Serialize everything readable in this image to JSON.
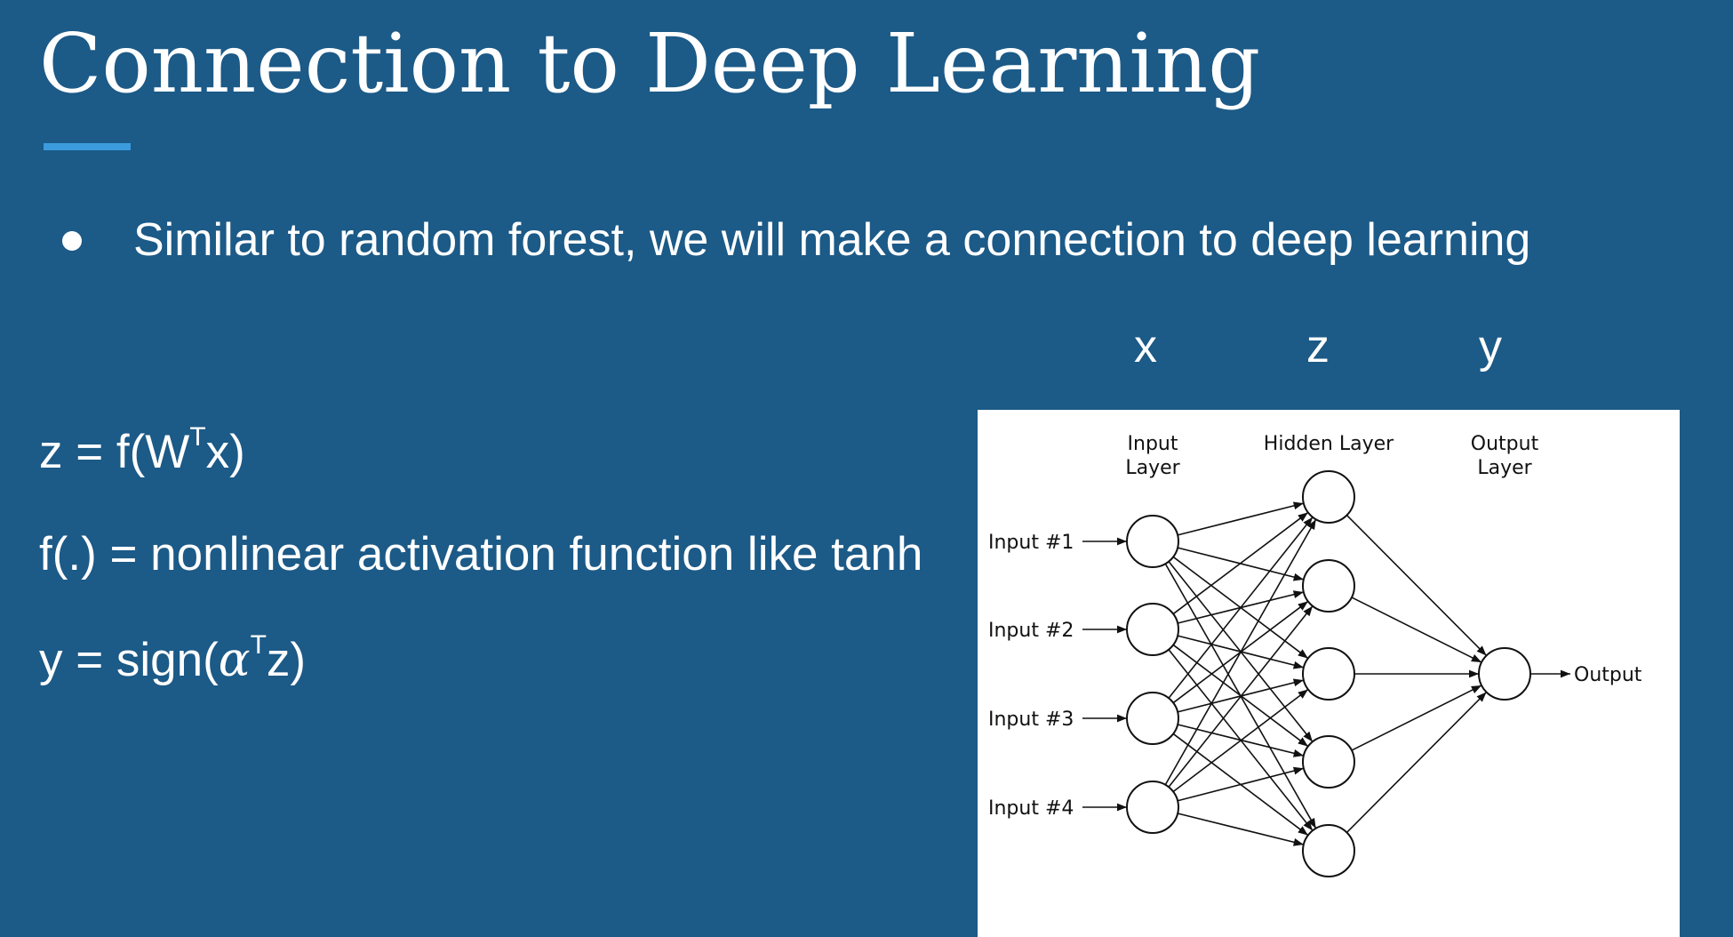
{
  "slide": {
    "title": "Connection to Deep Learning",
    "bullets": [
      "Similar to random forest, we will make a connection to deep learning"
    ]
  },
  "equations": {
    "eq1": {
      "prefix": "z = f(W",
      "sup": "T",
      "suffix": "x)"
    },
    "eq2": {
      "text": "f(.) = nonlinear activation function like tanh"
    },
    "eq3": {
      "prefix": "y = sign(",
      "greek": "α",
      "sup": "T",
      "suffix": "z)"
    }
  },
  "variable_labels": [
    "x",
    "z",
    "y"
  ],
  "diagram": {
    "layer_labels": {
      "input": [
        "Input",
        "Layer"
      ],
      "hidden": [
        "Hidden Layer"
      ],
      "output": [
        "Output",
        "Layer"
      ]
    },
    "inputs": [
      "Input #1",
      "Input #2",
      "Input #3",
      "Input #4"
    ],
    "hidden_count": 5,
    "output_label": "Output",
    "colors": {
      "node_stroke": "#111111",
      "edge": "#111111",
      "background": "#ffffff"
    }
  }
}
